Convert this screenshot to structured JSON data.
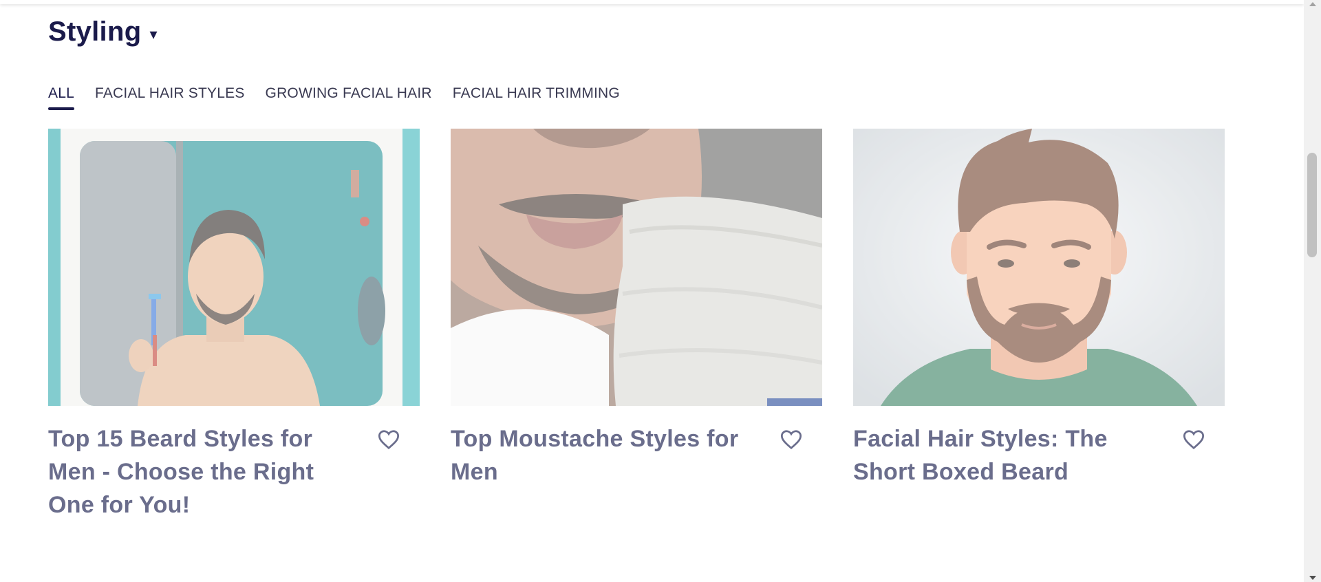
{
  "section": {
    "title": "Styling",
    "caret": "▾"
  },
  "tabs": [
    {
      "label": "ALL",
      "active": true
    },
    {
      "label": "FACIAL HAIR STYLES",
      "active": false
    },
    {
      "label": "GROWING FACIAL HAIR",
      "active": false
    },
    {
      "label": "FACIAL HAIR TRIMMING",
      "active": false
    }
  ],
  "articles": [
    {
      "title": "Top 15 Beard Styles for Men - Choose the Right One for You!",
      "image_icon": "man-shaving-mirror-photo",
      "favorite_icon": "heart-outline-icon"
    },
    {
      "title": "Top Moustache Styles for Men",
      "image_icon": "moustache-closeup-photo",
      "favorite_icon": "heart-outline-icon"
    },
    {
      "title": "Facial Hair Styles: The Short Boxed Beard",
      "image_icon": "boxed-beard-illustration",
      "favorite_icon": "heart-outline-icon"
    }
  ],
  "colors": {
    "navy": "#1b1b4b",
    "card_title": "#6a6d8c"
  }
}
